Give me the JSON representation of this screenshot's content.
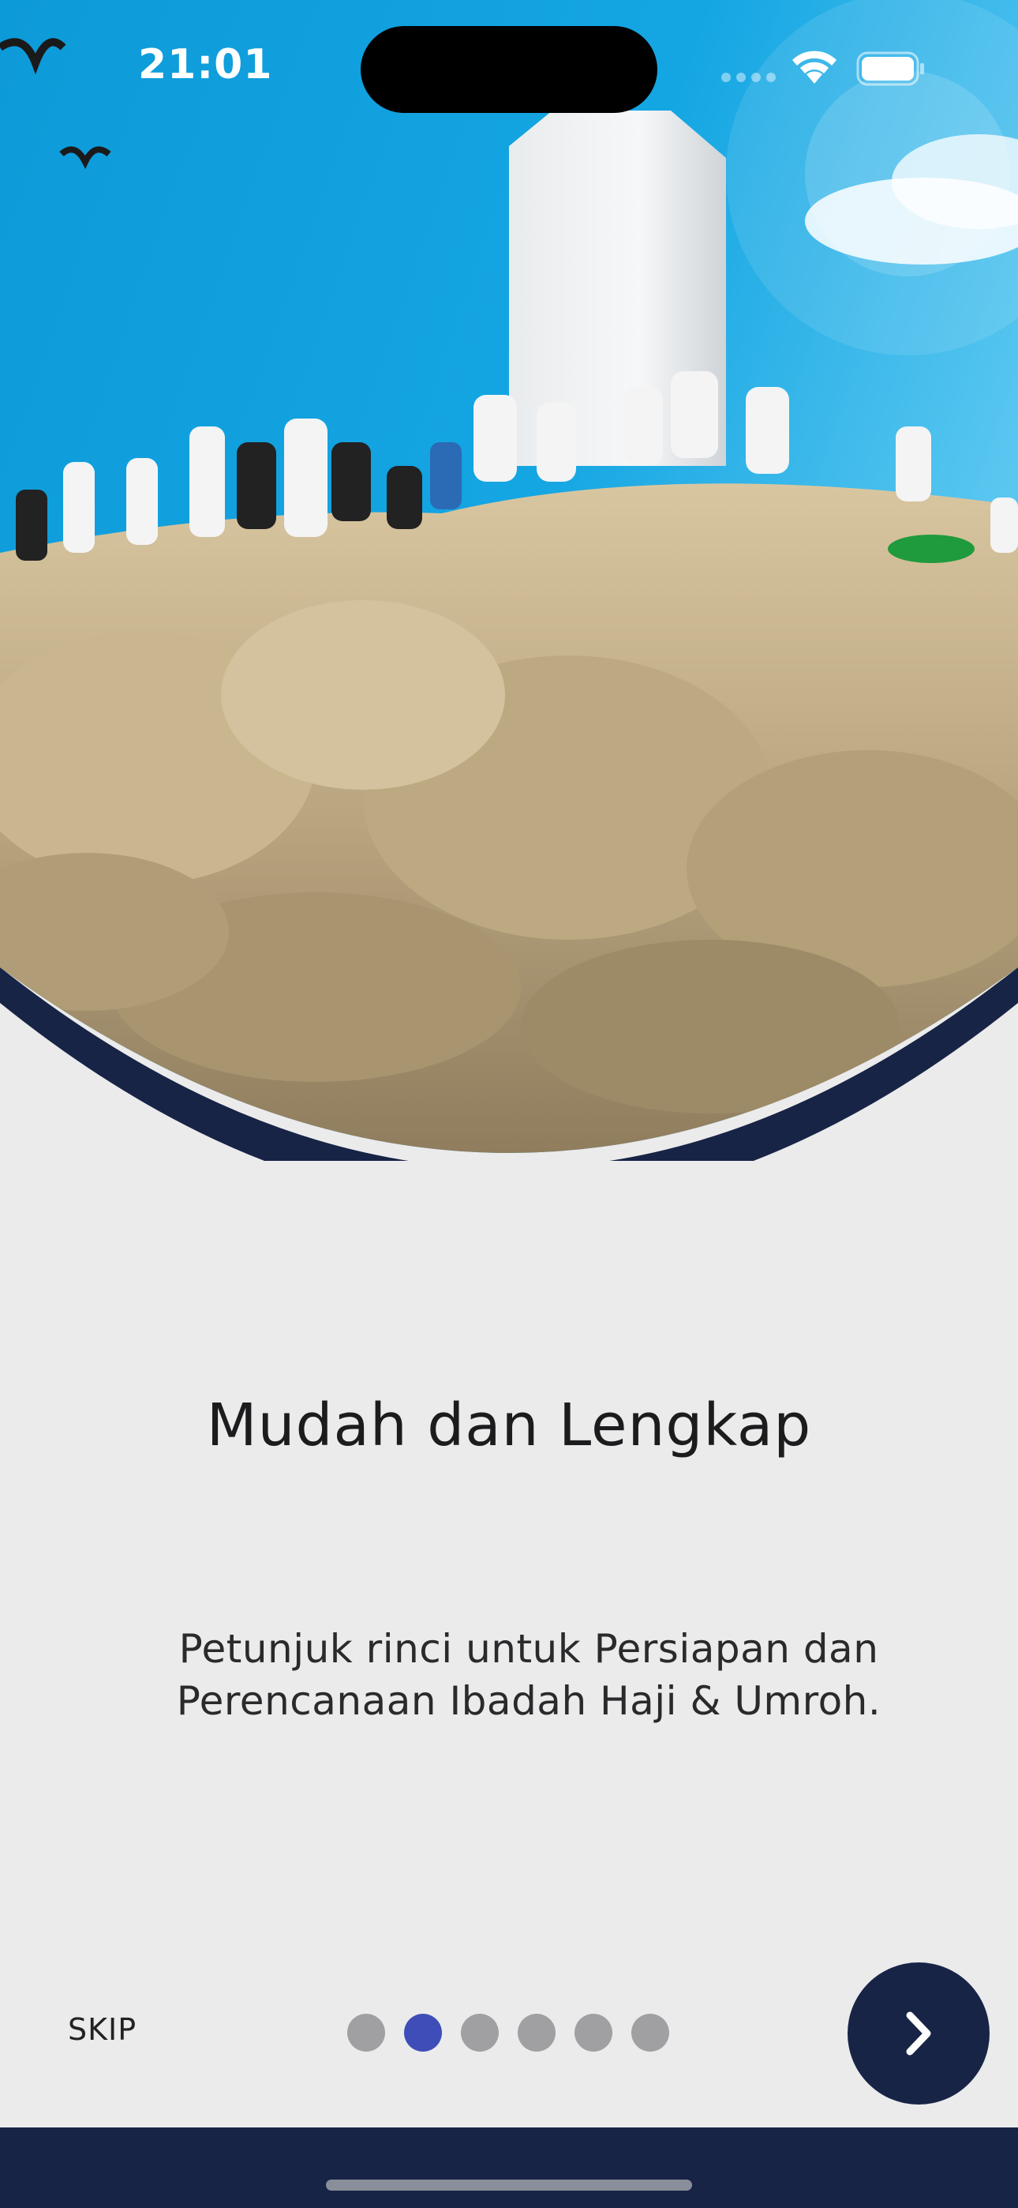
{
  "status_bar": {
    "time": "21:01",
    "icons": [
      "signal-icon",
      "wifi-icon",
      "battery-icon"
    ]
  },
  "hero": {
    "image": "hero-image-pilgrims-on-rocky-hill",
    "curve_color": "#172446"
  },
  "onboarding": {
    "title": "Mudah dan Lengkap",
    "description": "Petunjuk rinci untuk Persiapan dan Perencanaan Ibadah Haji & Umroh.",
    "skip_label": "SKIP",
    "page_count": 6,
    "current_page": 2,
    "next_icon": "chevron-right-icon"
  },
  "colors": {
    "accent": "#3f4db8",
    "navy": "#172446",
    "dot_inactive": "#a0a0a3",
    "background": "#ebebec"
  }
}
